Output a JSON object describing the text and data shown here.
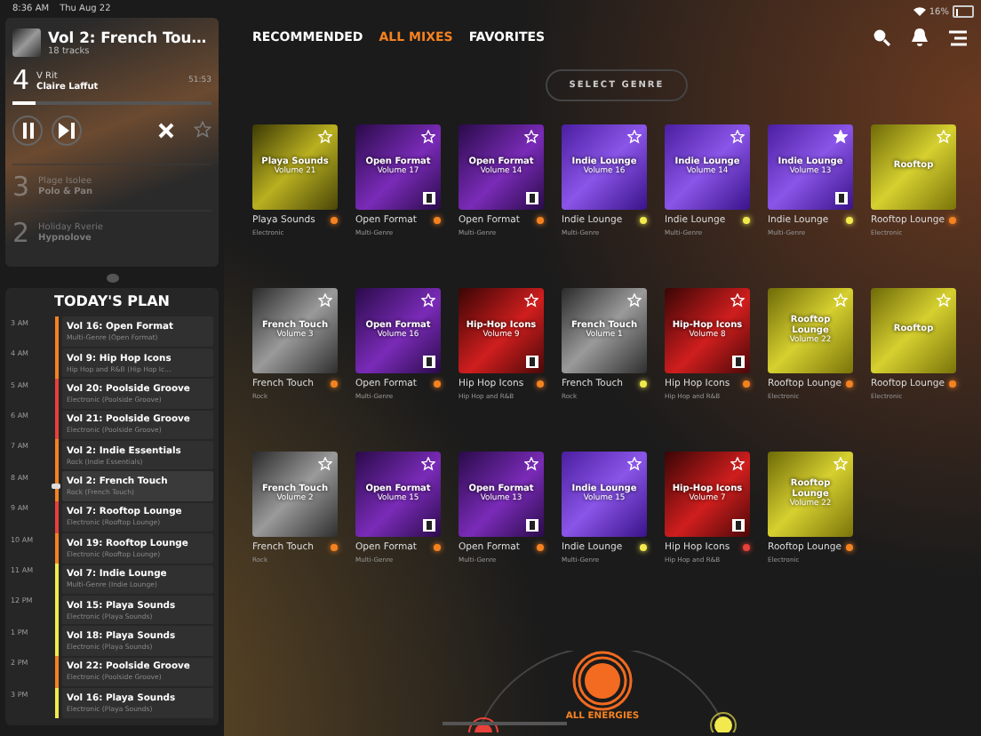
{
  "status_bar": {
    "time": "8:36 AM",
    "date": "Thu Aug 22",
    "battery": "16%"
  },
  "now_playing": {
    "title": "Vol 2: French Tou…",
    "tracks": "18 tracks",
    "number": "4",
    "track": "V Rit",
    "artist": "Claire Laffut",
    "duration": "51:53",
    "level": 0.12,
    "playing": true,
    "favorite": false
  },
  "queue": [
    {
      "number": "3",
      "track": "Plage Isolee",
      "artist": "Polo & Pan"
    },
    {
      "number": "2",
      "track": "Holiday Rverie",
      "artist": "Hypnolove"
    }
  ],
  "plan": {
    "title": "TODAY'S PLAN",
    "items": [
      {
        "time": "3 AM",
        "title": "Vol 16: Open Format",
        "subtitle": "Multi-Genre (Open Format)",
        "color": "#f58220",
        "selected": false
      },
      {
        "time": "4 AM",
        "title": "Vol 9: Hip Hop Icons",
        "subtitle": "Hip Hop and R&B (Hip Hop Ic...",
        "color": "#f58220",
        "selected": false
      },
      {
        "time": "5 AM",
        "title": "Vol 20: Poolside Groove",
        "subtitle": "Electronic (Poolside Groove)",
        "color": "#e8403a",
        "selected": false
      },
      {
        "time": "6 AM",
        "title": "Vol 21: Poolside Groove",
        "subtitle": "Electronic (Poolside Groove)",
        "color": "#e8403a",
        "selected": false
      },
      {
        "time": "7 AM",
        "title": "Vol 2: Indie Essentials",
        "subtitle": "Rock (Indie Essentials)",
        "color": "#f58220",
        "selected": false
      },
      {
        "time": "8 AM",
        "title": "Vol 2: French Touch",
        "subtitle": "Rock (French Touch)",
        "color": "#f58220",
        "selected": true
      },
      {
        "time": "9 AM",
        "title": "Vol 7: Rooftop Lounge",
        "subtitle": "Electronic (Rooftop Lounge)",
        "color": "#e8403a",
        "selected": false
      },
      {
        "time": "10 AM",
        "title": "Vol 19: Rooftop Lounge",
        "subtitle": "Electronic (Rooftop Lounge)",
        "color": "#f58220",
        "selected": false
      },
      {
        "time": "11 AM",
        "title": "Vol 7: Indie Lounge",
        "subtitle": "Multi-Genre (Indie Lounge)",
        "color": "#f2e94e",
        "selected": false
      },
      {
        "time": "12 PM",
        "title": "Vol 15: Playa Sounds",
        "subtitle": "Electronic (Playa Sounds)",
        "color": "#f2e94e",
        "selected": false
      },
      {
        "time": "1 PM",
        "title": "Vol 18: Playa Sounds",
        "subtitle": "Electronic (Playa Sounds)",
        "color": "#f2e94e",
        "selected": false
      },
      {
        "time": "2 PM",
        "title": "Vol 22: Poolside Groove",
        "subtitle": "Electronic (Poolside Groove)",
        "color": "#f58220",
        "selected": false
      },
      {
        "time": "3 PM",
        "title": "Vol 16: Playa Sounds",
        "subtitle": "Electronic (Playa Sounds)",
        "color": "#f2e94e",
        "selected": false
      }
    ]
  },
  "tabs": [
    {
      "label": "RECOMMENDED",
      "selected": false
    },
    {
      "label": "ALL MIXES",
      "selected": true
    },
    {
      "label": "FAVORITES",
      "selected": false
    }
  ],
  "genre_button": "SELECT GENRE",
  "mixes": [
    {
      "kind": "yellow",
      "cover_title": "Playa Sounds",
      "cover_volume": "Volume 21",
      "name": "Playa Sounds",
      "genre": "Electronic",
      "color": "#f58220",
      "favorite": false,
      "explicit": false
    },
    {
      "kind": "purple",
      "cover_title": "Open Format",
      "cover_volume": "Volume 17",
      "name": "Open Format",
      "genre": "Multi-Genre",
      "color": "#f58220",
      "favorite": false,
      "explicit": true
    },
    {
      "kind": "purple",
      "cover_title": "Open Format",
      "cover_volume": "Volume 14",
      "name": "Open Format",
      "genre": "Multi-Genre",
      "color": "#f58220",
      "favorite": false,
      "explicit": true
    },
    {
      "kind": "violet",
      "cover_title": "Indie Lounge",
      "cover_volume": "Volume 16",
      "name": "Indie Lounge",
      "genre": "Multi-Genre",
      "color": "#f2e94e",
      "favorite": false,
      "explicit": false
    },
    {
      "kind": "violet",
      "cover_title": "Indie Lounge",
      "cover_volume": "Volume 14",
      "name": "Indie Lounge",
      "genre": "Multi-Genre",
      "color": "#f2e94e",
      "favorite": false,
      "explicit": false
    },
    {
      "kind": "violet",
      "cover_title": "Indie Lounge",
      "cover_volume": "Volume 13",
      "name": "Indie Lounge",
      "genre": "Multi-Genre",
      "color": "#f2e94e",
      "favorite": true,
      "explicit": true
    },
    {
      "kind": "gold",
      "cover_title": "Rooftop",
      "name": "Rooftop Lounge",
      "genre": "Electronic",
      "color": "#f58220",
      "favorite": false,
      "explicit": false
    },
    {
      "kind": "gray",
      "cover_title": "French Touch",
      "cover_volume": "Volume 3",
      "name": "French Touch",
      "genre": "Rock",
      "color": "#f58220",
      "favorite": false,
      "explicit": false
    },
    {
      "kind": "purple",
      "cover_title": "Open Format",
      "cover_volume": "Volume 16",
      "name": "Open Format",
      "genre": "Multi-Genre",
      "color": "#f58220",
      "favorite": false,
      "explicit": true
    },
    {
      "kind": "red",
      "cover_title": "Hip-Hop Icons",
      "cover_volume": "Volume 9",
      "name": "Hip Hop Icons",
      "genre": "Hip Hop and R&B",
      "color": "#f58220",
      "favorite": false,
      "explicit": true
    },
    {
      "kind": "gray",
      "cover_title": "French Touch",
      "cover_volume": "Volume 1",
      "name": "French Touch",
      "genre": "Rock",
      "color": "#f2e94e",
      "favorite": false,
      "explicit": false
    },
    {
      "kind": "red",
      "cover_title": "Hip-Hop Icons",
      "cover_volume": "Volume 8",
      "name": "Hip Hop Icons",
      "genre": "Hip Hop and R&B",
      "color": "#f58220",
      "favorite": false,
      "explicit": true
    },
    {
      "kind": "gold",
      "cover_title": "Rooftop Lounge",
      "cover_volume": "Volume 22",
      "name": "Rooftop Lounge",
      "genre": "Electronic",
      "color": "#f58220",
      "favorite": false,
      "explicit": false
    },
    {
      "kind": "gold",
      "cover_title": "Rooftop",
      "name": "Rooftop Lounge",
      "genre": "Electronic",
      "color": "#f58220",
      "favorite": false,
      "explicit": false
    },
    {
      "kind": "gray",
      "cover_title": "French Touch",
      "cover_volume": "Volume 2",
      "name": "French Touch",
      "genre": "Rock",
      "color": "#f58220",
      "favorite": false,
      "explicit": false
    },
    {
      "kind": "purple",
      "cover_title": "Open Format",
      "cover_volume": "Volume 15",
      "name": "Open Format",
      "genre": "Multi-Genre",
      "color": "#f58220",
      "favorite": false,
      "explicit": true
    },
    {
      "kind": "purple",
      "cover_title": "Open Format",
      "cover_volume": "Volume 13",
      "name": "Open Format",
      "genre": "Multi-Genre",
      "color": "#f58220",
      "favorite": false,
      "explicit": true
    },
    {
      "kind": "violet",
      "cover_title": "Indie Lounge",
      "cover_volume": "Volume 15",
      "name": "Indie Lounge",
      "genre": "Multi-Genre",
      "color": "#f2e94e",
      "favorite": false,
      "explicit": false
    },
    {
      "kind": "red",
      "cover_title": "Hip-Hop Icons",
      "cover_volume": "Volume 7",
      "name": "Hip Hop Icons",
      "genre": "Hip Hop and R&B",
      "color": "#e8403a",
      "favorite": false,
      "explicit": true
    },
    {
      "kind": "gold",
      "cover_title": "Rooftop Lounge",
      "cover_volume": "Volume 22",
      "name": "Rooftop Lounge",
      "genre": "Electronic",
      "color": "#f58220",
      "favorite": false,
      "explicit": false
    }
  ],
  "energy": {
    "label": "ALL ENERGIES"
  }
}
